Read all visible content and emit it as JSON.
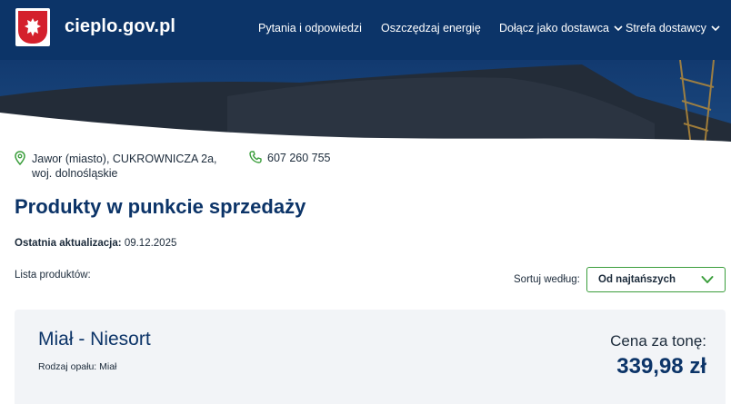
{
  "header": {
    "site_title": "cieplo.gov.pl",
    "nav": [
      {
        "label": "Pytania i odpowiedzi",
        "has_dropdown": false
      },
      {
        "label": "Oszczędzaj energię",
        "has_dropdown": false
      },
      {
        "label": "Dołącz jako dostawca",
        "has_dropdown": true
      },
      {
        "label": "Strefa dostawcy",
        "has_dropdown": true
      }
    ]
  },
  "contact": {
    "address_line1": "Jawor (miasto), CUKROWNICZA 2a,",
    "address_line2": "woj. dolnośląskie",
    "phone": "607 260 755",
    "address_icon": "map-pin-icon",
    "phone_icon": "phone-icon"
  },
  "main": {
    "title": "Produkty w punkcie sprzedaży",
    "updated_label": "Ostatnia aktualizacja:",
    "updated_value": "09.12.2025",
    "list_label": "Lista produktów:",
    "sort_label": "Sortuj według:",
    "sort_value": "Od najtańszych"
  },
  "products": [
    {
      "name": "Miał - Niesort",
      "fuel_type": "Rodzaj opału: Miał",
      "price_label": "Cena za tonę:",
      "price": "339,98 zł"
    }
  ],
  "colors": {
    "primary_navy": "#0c3468",
    "accent_green": "#3b9e3c",
    "card_bg": "#f2f4f7",
    "emblem_red": "#d4202c"
  }
}
